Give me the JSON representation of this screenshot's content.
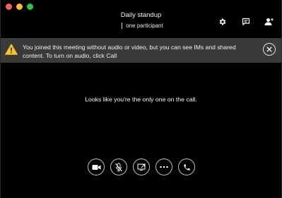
{
  "window": {
    "title": "Daily standup",
    "participants": "one participant"
  },
  "icons": {
    "settings": "gear-icon",
    "chat": "chat-icon",
    "add_participant": "add-person-icon",
    "warning": "warning-icon",
    "close": "close-icon",
    "video": "video-camera-icon",
    "mute": "microphone-muted-icon",
    "share": "screen-share-icon",
    "more": "more-icon",
    "call": "phone-icon"
  },
  "banner": {
    "message": "You joined this meeting without audio or video, but you can see IMs and shared content. To turn on audio, click Call"
  },
  "main": {
    "message": "Looks like you're the only one on the call."
  },
  "colors": {
    "background": "#000000",
    "banner": "#3a3a3a",
    "warning": "#f5c518"
  }
}
